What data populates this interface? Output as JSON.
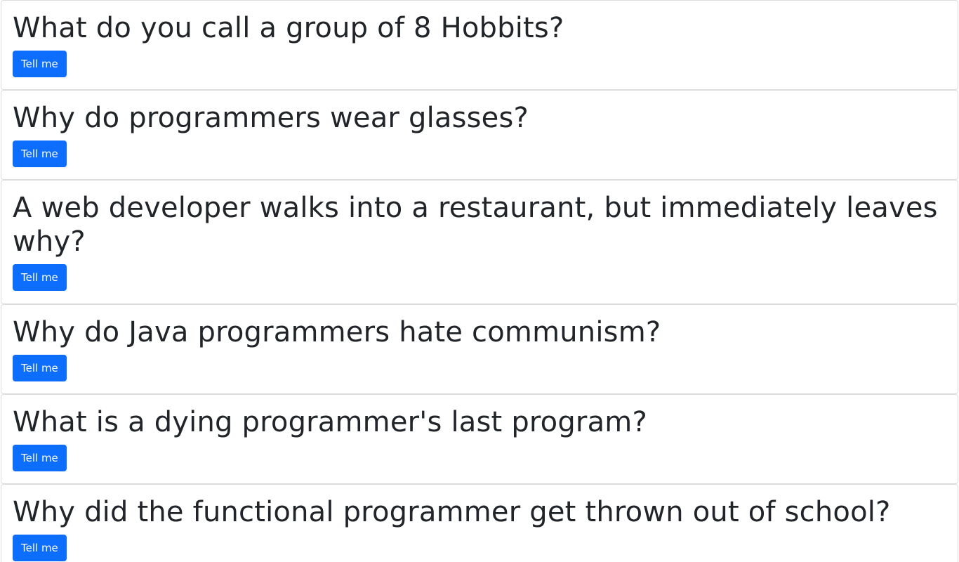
{
  "jokes": [
    {
      "question": "What do you call a group of 8 Hobbits?",
      "button_label": "Tell me"
    },
    {
      "question": "Why do programmers wear glasses?",
      "button_label": "Tell me"
    },
    {
      "question": "A web developer walks into a restaurant, but immediately leaves why?",
      "button_label": "Tell me"
    },
    {
      "question": "Why do Java programmers hate communism?",
      "button_label": "Tell me"
    },
    {
      "question": "What is a dying programmer's last program?",
      "button_label": "Tell me"
    },
    {
      "question": "Why did the functional programmer get thrown out of school?",
      "button_label": "Tell me"
    }
  ],
  "colors": {
    "button_bg": "#0d6efd",
    "button_text": "#ffffff",
    "text": "#212529",
    "card_border": "#dcdcdc"
  }
}
